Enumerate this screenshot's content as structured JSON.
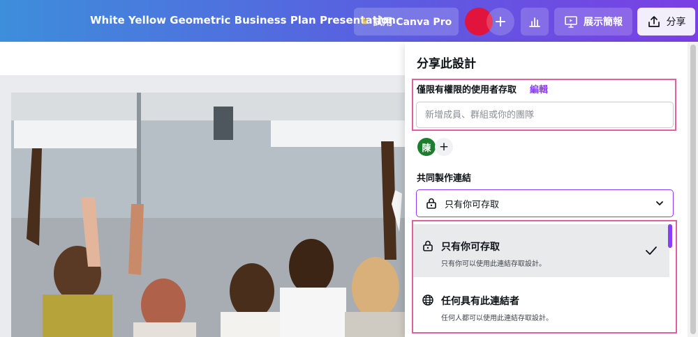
{
  "header": {
    "document_title": "White Yellow Geometric Business Plan Presentation",
    "pro_button_label": "試用 Canva Pro",
    "plus_label": "+",
    "present_label": "展示簡報",
    "share_label": "分享"
  },
  "share_panel": {
    "title": "分享此設計",
    "access_label": "僅限有權限的使用者存取",
    "edit_link": "編輯",
    "member_input_placeholder": "新增成員、群組或你的團隊",
    "member_input_value": "",
    "user_avatar_initial": "陳",
    "add_member_label": "+",
    "collab_label": "共同製作連結",
    "selected_option": "只有你可存取",
    "options": [
      {
        "title": "只有你可存取",
        "description": "只有你可以使用此連結存取設計。",
        "icon": "lock-icon",
        "selected": true
      },
      {
        "title": "任何具有此連結者",
        "description": "任何人都可以使用此連結存取設計。",
        "icon": "globe-icon",
        "selected": false
      }
    ]
  },
  "colors": {
    "accent": "#8b3dff",
    "highlight_border": "#e35fa2",
    "avatar_red": "#e0143c",
    "avatar_green": "#1d7d2e"
  }
}
